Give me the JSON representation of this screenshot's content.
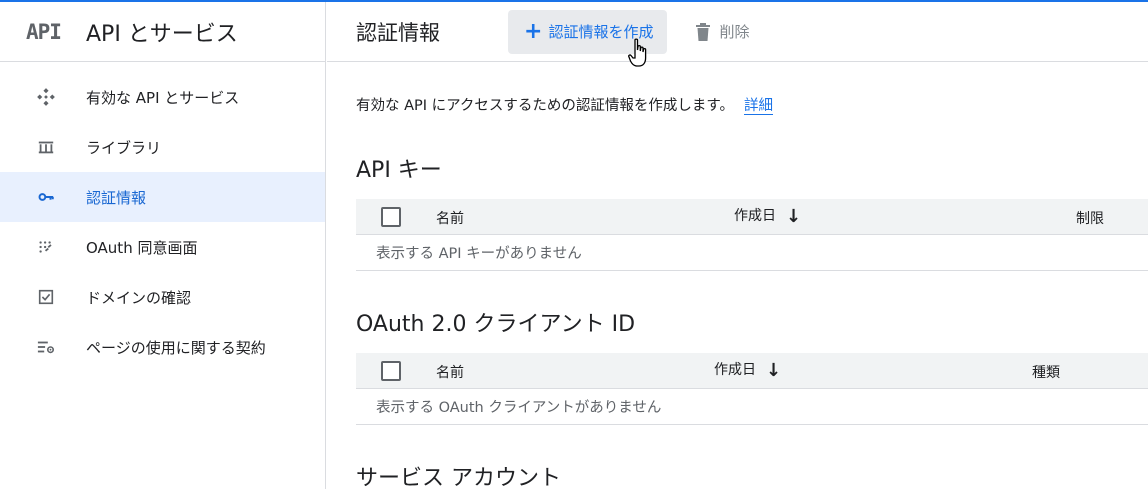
{
  "brand": {
    "logo_text": "API",
    "title": "API とサービス"
  },
  "sidebar": {
    "items": [
      {
        "label": "有効な API とサービス",
        "icon": "api-diamond-icon",
        "active": false
      },
      {
        "label": "ライブラリ",
        "icon": "library-icon",
        "active": false
      },
      {
        "label": "認証情報",
        "icon": "key-icon",
        "active": true
      },
      {
        "label": "OAuth 同意画面",
        "icon": "consent-dots-icon",
        "active": false
      },
      {
        "label": "ドメインの確認",
        "icon": "checkbox-verify-icon",
        "active": false
      },
      {
        "label": "ページの使用に関する契約",
        "icon": "settings-list-icon",
        "active": false
      }
    ]
  },
  "toolbar": {
    "title": "認証情報",
    "create_label": "認証情報を作成",
    "delete_label": "削除"
  },
  "intro": {
    "text": "有効な API にアクセスするための認証情報を作成します。",
    "link": "詳細"
  },
  "api_keys": {
    "title": "API キー",
    "columns": {
      "name": "名前",
      "created": "作成日",
      "restriction": "制限"
    },
    "empty": "表示する API キーがありません"
  },
  "oauth": {
    "title": "OAuth 2.0 クライアント ID",
    "columns": {
      "name": "名前",
      "created": "作成日",
      "type": "種類"
    },
    "empty": "表示する OAuth クライアントがありません"
  },
  "service_accounts": {
    "title": "サービス アカウント"
  },
  "colors": {
    "accent": "#1a73e8",
    "active_bg": "#e8f0fe",
    "header_bg": "#f1f3f4",
    "border": "#dadce0"
  }
}
